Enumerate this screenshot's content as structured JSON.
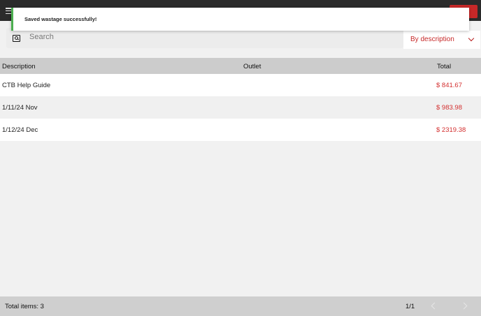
{
  "toast": {
    "message": "Saved wastage successfully!"
  },
  "search": {
    "placeholder": "Search"
  },
  "sort": {
    "selected": "By description"
  },
  "table": {
    "headers": {
      "description": "Description",
      "outlet": "Outlet",
      "total": "Total"
    },
    "rows": [
      {
        "description": "CTB Help Guide",
        "outlet": "",
        "total": "$ 841.67"
      },
      {
        "description": "1/11/24 Nov",
        "outlet": "",
        "total": "$ 983.98"
      },
      {
        "description": "1/12/24 Dec",
        "outlet": "",
        "total": "$ 2319.38"
      }
    ]
  },
  "footer": {
    "total_items": "Total items: 3",
    "page": "1/1"
  },
  "colors": {
    "accent": "#d32f2f",
    "toast_border": "#4caf50",
    "topbar": "#2b2b2b"
  },
  "icons": {
    "menu": "hamburger-menu-icon",
    "search": "search-icon",
    "sort": "chevron-down-icon",
    "prev": "chevron-left-icon",
    "next": "chevron-right-icon"
  }
}
